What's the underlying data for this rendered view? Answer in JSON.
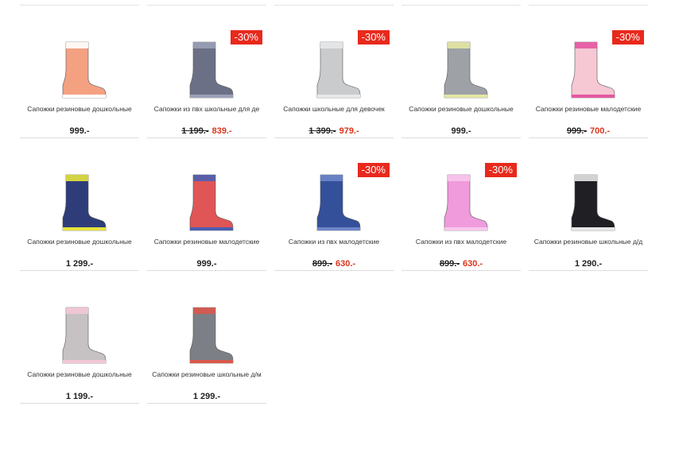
{
  "products": [
    {
      "name": "Сапожки резиновые дошкольные",
      "price": "999.-",
      "old": "",
      "new": "",
      "badge": "",
      "color": "#f4a182",
      "accent": "#ffffff"
    },
    {
      "name": "Сапожки из пвх школьные для де",
      "price": "",
      "old": "1 199.-",
      "new": "839.-",
      "badge": "-30%",
      "color": "#6c7086",
      "accent": "#9aa0b5"
    },
    {
      "name": "Сапожки школьные для девочек",
      "price": "",
      "old": "1 399.-",
      "new": "979.-",
      "badge": "-30%",
      "color": "#c9cbcd",
      "accent": "#e7e8ea"
    },
    {
      "name": "Сапожки резиновые дошкольные",
      "price": "999.-",
      "old": "",
      "new": "",
      "badge": "",
      "color": "#9ea1a6",
      "accent": "#e3e6a3"
    },
    {
      "name": "Сапожки резиновые малодетские",
      "price": "",
      "old": "999.-",
      "new": "700.-",
      "badge": "-30%",
      "color": "#f5c8d4",
      "accent": "#e657a1"
    },
    {
      "name": "Сапожки резиновые дошкольные",
      "price": "1 299.-",
      "old": "",
      "new": "",
      "badge": "",
      "color": "#2e3d7a",
      "accent": "#e7e33b"
    },
    {
      "name": "Сапожки резиновые малодетские",
      "price": "999.-",
      "old": "",
      "new": "",
      "badge": "",
      "color": "#e05555",
      "accent": "#4b5fb0"
    },
    {
      "name": "Сапожки из пвх малодетские",
      "price": "",
      "old": "899.-",
      "new": "630.-",
      "badge": "-30%",
      "color": "#34509a",
      "accent": "#6d86c9"
    },
    {
      "name": "Сапожки из пвх малодетские",
      "price": "",
      "old": "899.-",
      "new": "630.-",
      "badge": "-30%",
      "color": "#f09bdc",
      "accent": "#f7c6ec"
    },
    {
      "name": "Сапожки резиновые школьные д/д",
      "price": "1 290.-",
      "old": "",
      "new": "",
      "badge": "",
      "color": "#1f1f24",
      "accent": "#e6e6e6"
    },
    {
      "name": "Сапожки резиновые дошкольные",
      "price": "1 199.-",
      "old": "",
      "new": "",
      "badge": "",
      "color": "#c6c2c3",
      "accent": "#f3c7d7"
    },
    {
      "name": "Сапожки резиновые школьные д/м",
      "price": "1 299.-",
      "old": "",
      "new": "",
      "badge": "",
      "color": "#7d7f86",
      "accent": "#d9584c"
    }
  ]
}
